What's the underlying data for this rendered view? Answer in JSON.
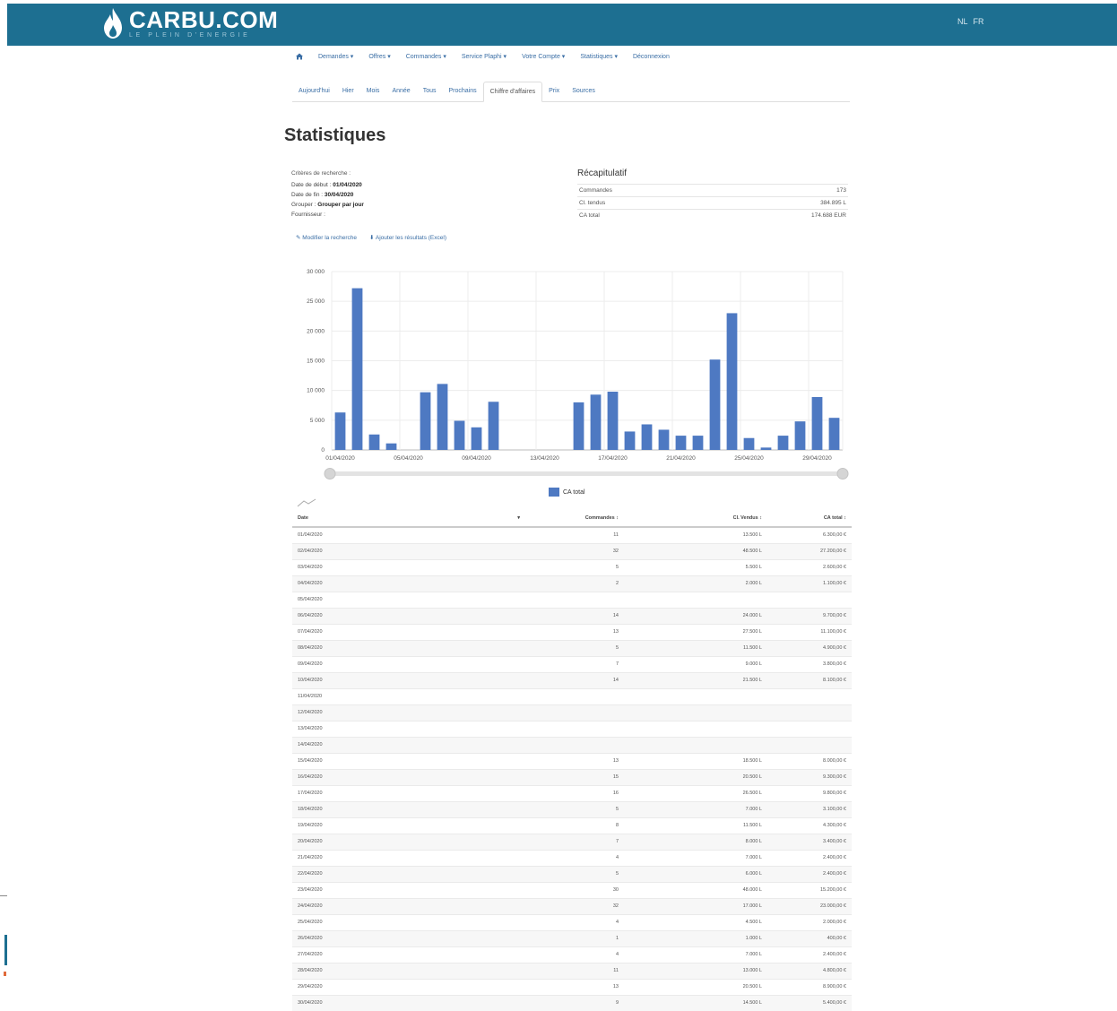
{
  "brand": {
    "name": "CARBU.COM",
    "tagline": "LE PLEIN D'ENERGIE"
  },
  "language_switch": [
    "NL",
    "FR"
  ],
  "main_nav": [
    "Demandes ▾",
    "Offres ▾",
    "Commandes ▾",
    "Service Plaphi ▾",
    "Votre Compte ▾",
    "Statistiques ▾",
    "Déconnexion"
  ],
  "sub_nav": [
    "Aujourd'hui",
    "Hier",
    "Mois",
    "Année",
    "Tous",
    "Prochains",
    "Chiffre d'affaires",
    "Prix",
    "Sources"
  ],
  "sub_nav_active": "Chiffre d'affaires",
  "page_title": "Statistiques",
  "criteria": {
    "heading": "Critères de recherche :",
    "start_label": "Date de début :",
    "start_value": "01/04/2020",
    "end_label": "Date de fin :",
    "end_value": "30/04/2020",
    "group_label": "Grouper :",
    "group_value": "Grouper par jour",
    "supplier_label": "Fournisseur :",
    "supplier_value": ""
  },
  "actions": [
    "Modifier la recherche",
    "Ajouter les résultats (Excel)"
  ],
  "recap": {
    "title": "Récapitulatif",
    "rows": [
      {
        "label": "Commandes",
        "value": "173"
      },
      {
        "label": "Cl. tendus",
        "value": "384.895 L"
      },
      {
        "label": "CA total",
        "value": "174.688 EUR"
      }
    ]
  },
  "chart_data": {
    "type": "bar",
    "categories": [
      "01/04/2020",
      "02/04/2020",
      "03/04/2020",
      "04/04/2020",
      "05/04/2020",
      "06/04/2020",
      "07/04/2020",
      "08/04/2020",
      "09/04/2020",
      "10/04/2020",
      "11/04/2020",
      "12/04/2020",
      "13/04/2020",
      "14/04/2020",
      "15/04/2020",
      "16/04/2020",
      "17/04/2020",
      "18/04/2020",
      "19/04/2020",
      "20/04/2020",
      "21/04/2020",
      "22/04/2020",
      "23/04/2020",
      "24/04/2020",
      "25/04/2020",
      "26/04/2020",
      "27/04/2020",
      "28/04/2020",
      "29/04/2020",
      "30/04/2020"
    ],
    "tick_labels": [
      "01/04/2020",
      "05/04/2020",
      "09/04/2020",
      "13/04/2020",
      "17/04/2020",
      "21/04/2020",
      "25/04/2020",
      "29/04/2020"
    ],
    "series": [
      {
        "name": "CA total",
        "values": [
          6300,
          27200,
          2600,
          1100,
          0,
          9700,
          11100,
          4900,
          3800,
          8100,
          0,
          0,
          0,
          0,
          8000,
          9300,
          9800,
          3100,
          4300,
          3400,
          2400,
          2400,
          15200,
          23000,
          2000,
          400,
          2400,
          4800,
          8900,
          5400
        ]
      }
    ],
    "ylim": [
      0,
      30000
    ],
    "yticks": [
      0,
      5000,
      10000,
      15000,
      20000,
      25000,
      30000
    ],
    "ytick_labels": [
      "0",
      "5 000",
      "10 000",
      "15 000",
      "20 000",
      "25 000",
      "30 000"
    ],
    "grid": true,
    "legend": "bottom",
    "color": "#4e79c2"
  },
  "table": {
    "headers": [
      "Date",
      "Commandes",
      "Cl. Vendus",
      "CA total"
    ],
    "rows": [
      [
        "01/04/2020",
        "11",
        "13.500 L",
        "6.300,00 €"
      ],
      [
        "02/04/2020",
        "32",
        "48.500 L",
        "27.200,00 €"
      ],
      [
        "03/04/2020",
        "5",
        "5.500 L",
        "2.600,00 €"
      ],
      [
        "04/04/2020",
        "2",
        "2.000 L",
        "1.100,00 €"
      ],
      [
        "05/04/2020",
        "",
        "",
        ""
      ],
      [
        "06/04/2020",
        "14",
        "24.000 L",
        "9.700,00 €"
      ],
      [
        "07/04/2020",
        "13",
        "27.500 L",
        "11.100,00 €"
      ],
      [
        "08/04/2020",
        "5",
        "11.500 L",
        "4.900,00 €"
      ],
      [
        "09/04/2020",
        "7",
        "9.000 L",
        "3.800,00 €"
      ],
      [
        "10/04/2020",
        "14",
        "21.500 L",
        "8.100,00 €"
      ],
      [
        "11/04/2020",
        "",
        "",
        ""
      ],
      [
        "12/04/2020",
        "",
        "",
        ""
      ],
      [
        "13/04/2020",
        "",
        "",
        ""
      ],
      [
        "14/04/2020",
        "",
        "",
        ""
      ],
      [
        "15/04/2020",
        "13",
        "18.500 L",
        "8.000,00 €"
      ],
      [
        "16/04/2020",
        "15",
        "20.500 L",
        "9.300,00 €"
      ],
      [
        "17/04/2020",
        "16",
        "26.500 L",
        "9.800,00 €"
      ],
      [
        "18/04/2020",
        "5",
        "7.000 L",
        "3.100,00 €"
      ],
      [
        "19/04/2020",
        "8",
        "11.500 L",
        "4.300,00 €"
      ],
      [
        "20/04/2020",
        "7",
        "8.000 L",
        "3.400,00 €"
      ],
      [
        "21/04/2020",
        "4",
        "7.000 L",
        "2.400,00 €"
      ],
      [
        "22/04/2020",
        "5",
        "6.000 L",
        "2.400,00 €"
      ],
      [
        "23/04/2020",
        "30",
        "48.000 L",
        "15.200,00 €"
      ],
      [
        "24/04/2020",
        "32",
        "17.000 L",
        "23.000,00 €"
      ],
      [
        "25/04/2020",
        "4",
        "4.500 L",
        "2.000,00 €"
      ],
      [
        "26/04/2020",
        "1",
        "1.000 L",
        "400,00 €"
      ],
      [
        "27/04/2020",
        "4",
        "7.000 L",
        "2.400,00 €"
      ],
      [
        "28/04/2020",
        "11",
        "13.000 L",
        "4.800,00 €"
      ],
      [
        "29/04/2020",
        "13",
        "20.500 L",
        "8.900,00 €"
      ],
      [
        "30/04/2020",
        "9",
        "14.500 L",
        "5.400,00 €"
      ]
    ]
  }
}
